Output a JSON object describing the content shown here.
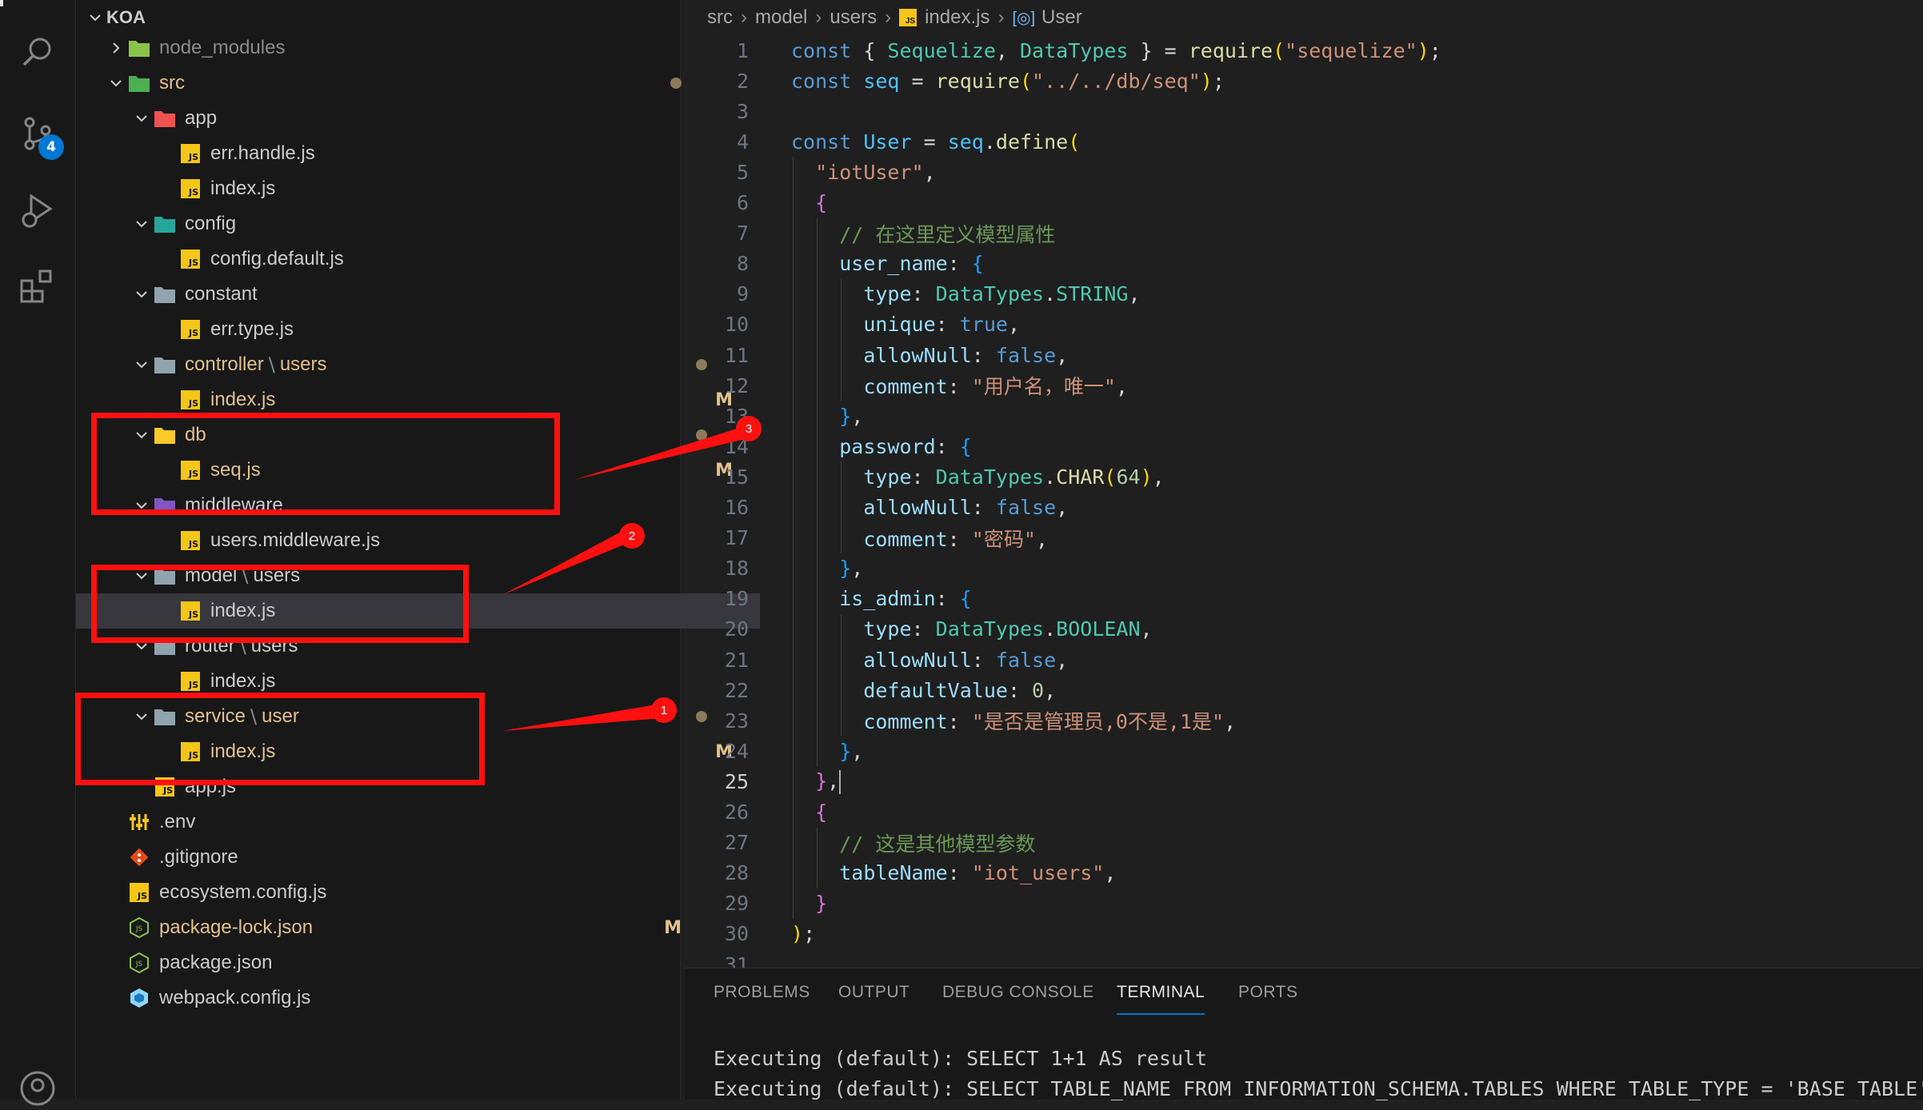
{
  "activity_bar": {
    "items": [
      {
        "name": "explorer-icon"
      },
      {
        "name": "search-icon"
      },
      {
        "name": "source-control-icon"
      },
      {
        "name": "run-debug-icon"
      },
      {
        "name": "extensions-icon"
      },
      {
        "name": "account-icon"
      }
    ],
    "scm_badge": "4"
  },
  "explorer": {
    "root": "KOA",
    "rows": [
      {
        "label": "node_modules",
        "depth": 1,
        "chevron": "right",
        "icon": "folder-green",
        "dim": true,
        "status": ""
      },
      {
        "label": "src",
        "depth": 1,
        "chevron": "down",
        "icon": "folder-src",
        "mod": true,
        "status": "dot"
      },
      {
        "label": "app",
        "depth": 2,
        "chevron": "down",
        "icon": "folder-app",
        "status": ""
      },
      {
        "label": "err.handle.js",
        "depth": 3,
        "icon": "js",
        "status": ""
      },
      {
        "label": "index.js",
        "depth": 3,
        "icon": "js",
        "status": ""
      },
      {
        "label": "config",
        "depth": 2,
        "chevron": "down",
        "icon": "folder-config",
        "status": ""
      },
      {
        "label": "config.default.js",
        "depth": 3,
        "icon": "js",
        "status": ""
      },
      {
        "label": "constant",
        "depth": 2,
        "chevron": "down",
        "icon": "folder-constant",
        "status": ""
      },
      {
        "label": "err.type.js",
        "depth": 3,
        "icon": "js",
        "status": ""
      },
      {
        "label": "controller",
        "label2": "users",
        "depth": 2,
        "chevron": "down",
        "icon": "folder-plain",
        "mod": true,
        "status": "dot"
      },
      {
        "label": "index.js",
        "depth": 3,
        "icon": "js",
        "mod": true,
        "status": "M"
      },
      {
        "label": "db",
        "depth": 2,
        "chevron": "down",
        "icon": "folder-db",
        "mod": true,
        "status": "dot"
      },
      {
        "label": "seq.js",
        "depth": 3,
        "icon": "js",
        "mod": true,
        "status": "M"
      },
      {
        "label": "middleware",
        "depth": 2,
        "chevron": "down",
        "icon": "folder-mw",
        "status": ""
      },
      {
        "label": "users.middleware.js",
        "depth": 3,
        "icon": "js",
        "status": ""
      },
      {
        "label": "model",
        "label2": "users",
        "depth": 2,
        "chevron": "down",
        "icon": "folder-plain",
        "status": ""
      },
      {
        "label": "index.js",
        "depth": 3,
        "icon": "js",
        "status": "",
        "selected": true
      },
      {
        "label": "router",
        "label2": "users",
        "depth": 2,
        "chevron": "down",
        "icon": "folder-plain",
        "status": ""
      },
      {
        "label": "index.js",
        "depth": 3,
        "icon": "js",
        "status": ""
      },
      {
        "label": "service",
        "label2": "user",
        "depth": 2,
        "chevron": "down",
        "icon": "folder-plain",
        "mod": true,
        "status": "dot"
      },
      {
        "label": "index.js",
        "depth": 3,
        "icon": "js",
        "mod": true,
        "status": "M"
      },
      {
        "label": "app.js",
        "depth": 2,
        "icon": "js",
        "status": ""
      },
      {
        "label": ".env",
        "depth": 1,
        "icon": "env",
        "status": ""
      },
      {
        "label": ".gitignore",
        "depth": 1,
        "icon": "git",
        "status": ""
      },
      {
        "label": "ecosystem.config.js",
        "depth": 1,
        "icon": "js",
        "status": ""
      },
      {
        "label": "package-lock.json",
        "depth": 1,
        "icon": "node",
        "mod": true,
        "status": "M"
      },
      {
        "label": "package.json",
        "depth": 1,
        "icon": "node",
        "status": ""
      },
      {
        "label": "webpack.config.js",
        "depth": 1,
        "icon": "webpack",
        "status": ""
      }
    ]
  },
  "breadcrumb": [
    "src",
    "model",
    "users",
    "index.js",
    "User"
  ],
  "editor": {
    "active_line": 25,
    "lines": [
      [
        [
          "k",
          "const "
        ],
        [
          "w",
          "{ "
        ],
        [
          "t",
          "Sequelize"
        ],
        [
          "w",
          ", "
        ],
        [
          "t",
          "DataTypes"
        ],
        [
          "w",
          " } = "
        ],
        [
          "f",
          "require"
        ],
        [
          "b1",
          "("
        ],
        [
          "s",
          "\"sequelize\""
        ],
        [
          "b1",
          ")"
        ],
        [
          "w",
          ";"
        ]
      ],
      [
        [
          "k",
          "const "
        ],
        [
          "v",
          "seq"
        ],
        [
          "w",
          " = "
        ],
        [
          "f",
          "require"
        ],
        [
          "b1",
          "("
        ],
        [
          "s",
          "\"../../db/seq\""
        ],
        [
          "b1",
          ")"
        ],
        [
          "w",
          ";"
        ]
      ],
      [],
      [
        [
          "k",
          "const "
        ],
        [
          "v",
          "User"
        ],
        [
          "w",
          " = "
        ],
        [
          "v",
          "seq"
        ],
        [
          "w",
          "."
        ],
        [
          "f",
          "define"
        ],
        [
          "b1",
          "("
        ]
      ],
      [
        [
          "w",
          "  "
        ],
        [
          "s",
          "\"iotUser\""
        ],
        [
          "w",
          ","
        ]
      ],
      [
        [
          "w",
          "  "
        ],
        [
          "b2",
          "{"
        ]
      ],
      [
        [
          "w",
          "    "
        ],
        [
          "c",
          "// 在这里定义模型属性"
        ]
      ],
      [
        [
          "w",
          "    "
        ],
        [
          "p",
          "user_name"
        ],
        [
          "w",
          ": "
        ],
        [
          "b3",
          "{"
        ]
      ],
      [
        [
          "w",
          "      "
        ],
        [
          "p",
          "type"
        ],
        [
          "w",
          ": "
        ],
        [
          "t",
          "DataTypes"
        ],
        [
          "w",
          "."
        ],
        [
          "t",
          "STRING"
        ],
        [
          "w",
          ","
        ]
      ],
      [
        [
          "w",
          "      "
        ],
        [
          "p",
          "unique"
        ],
        [
          "w",
          ": "
        ],
        [
          "k",
          "true"
        ],
        [
          "w",
          ","
        ]
      ],
      [
        [
          "w",
          "      "
        ],
        [
          "p",
          "allowNull"
        ],
        [
          "w",
          ": "
        ],
        [
          "k",
          "false"
        ],
        [
          "w",
          ","
        ]
      ],
      [
        [
          "w",
          "      "
        ],
        [
          "p",
          "comment"
        ],
        [
          "w",
          ": "
        ],
        [
          "s",
          "\"用户名，唯一\""
        ],
        [
          "w",
          ","
        ]
      ],
      [
        [
          "w",
          "    "
        ],
        [
          "b3",
          "}"
        ],
        [
          "w",
          ","
        ]
      ],
      [
        [
          "w",
          "    "
        ],
        [
          "p",
          "password"
        ],
        [
          "w",
          ": "
        ],
        [
          "b3",
          "{"
        ]
      ],
      [
        [
          "w",
          "      "
        ],
        [
          "p",
          "type"
        ],
        [
          "w",
          ": "
        ],
        [
          "t",
          "DataTypes"
        ],
        [
          "w",
          "."
        ],
        [
          "f",
          "CHAR"
        ],
        [
          "b1",
          "("
        ],
        [
          "n",
          "64"
        ],
        [
          "b1",
          ")"
        ],
        [
          "w",
          ","
        ]
      ],
      [
        [
          "w",
          "      "
        ],
        [
          "p",
          "allowNull"
        ],
        [
          "w",
          ": "
        ],
        [
          "k",
          "false"
        ],
        [
          "w",
          ","
        ]
      ],
      [
        [
          "w",
          "      "
        ],
        [
          "p",
          "comment"
        ],
        [
          "w",
          ": "
        ],
        [
          "s",
          "\"密码\""
        ],
        [
          "w",
          ","
        ]
      ],
      [
        [
          "w",
          "    "
        ],
        [
          "b3",
          "}"
        ],
        [
          "w",
          ","
        ]
      ],
      [
        [
          "w",
          "    "
        ],
        [
          "p",
          "is_admin"
        ],
        [
          "w",
          ": "
        ],
        [
          "b3",
          "{"
        ]
      ],
      [
        [
          "w",
          "      "
        ],
        [
          "p",
          "type"
        ],
        [
          "w",
          ": "
        ],
        [
          "t",
          "DataTypes"
        ],
        [
          "w",
          "."
        ],
        [
          "t",
          "BOOLEAN"
        ],
        [
          "w",
          ","
        ]
      ],
      [
        [
          "w",
          "      "
        ],
        [
          "p",
          "allowNull"
        ],
        [
          "w",
          ": "
        ],
        [
          "k",
          "false"
        ],
        [
          "w",
          ","
        ]
      ],
      [
        [
          "w",
          "      "
        ],
        [
          "p",
          "defaultValue"
        ],
        [
          "w",
          ": "
        ],
        [
          "n",
          "0"
        ],
        [
          "w",
          ","
        ]
      ],
      [
        [
          "w",
          "      "
        ],
        [
          "p",
          "comment"
        ],
        [
          "w",
          ": "
        ],
        [
          "s",
          "\"是否是管理员,0不是,1是\""
        ],
        [
          "w",
          ","
        ]
      ],
      [
        [
          "w",
          "    "
        ],
        [
          "b3",
          "}"
        ],
        [
          "w",
          ","
        ]
      ],
      [
        [
          "w",
          "  "
        ],
        [
          "b2",
          "}"
        ],
        [
          "w",
          ","
        ]
      ],
      [
        [
          "w",
          "  "
        ],
        [
          "b2",
          "{"
        ]
      ],
      [
        [
          "w",
          "    "
        ],
        [
          "c",
          "// 这是其他模型参数"
        ]
      ],
      [
        [
          "w",
          "    "
        ],
        [
          "p",
          "tableName"
        ],
        [
          "w",
          ": "
        ],
        [
          "s",
          "\"iot_users\""
        ],
        [
          "w",
          ","
        ]
      ],
      [
        [
          "w",
          "  "
        ],
        [
          "b2",
          "}"
        ]
      ],
      [
        [
          "b1",
          ")"
        ],
        [
          "w",
          ";"
        ]
      ],
      []
    ]
  },
  "panel": {
    "tabs": [
      "PROBLEMS",
      "OUTPUT",
      "DEBUG CONSOLE",
      "TERMINAL",
      "PORTS"
    ],
    "active_tab": "TERMINAL",
    "terminal_lines": [
      "Executing (default): SELECT 1+1 AS result",
      "Executing (default): SELECT TABLE_NAME FROM INFORMATION_SCHEMA.TABLES WHERE TABLE_TYPE = 'BASE TABLE'"
    ]
  },
  "annotations": [
    {
      "number": "3"
    },
    {
      "number": "2"
    },
    {
      "number": "1"
    }
  ],
  "colors": {
    "annotation": "#ff1010",
    "accent": "#0078d4",
    "js_icon": "#f5c518",
    "modified": "#e2c08d"
  }
}
